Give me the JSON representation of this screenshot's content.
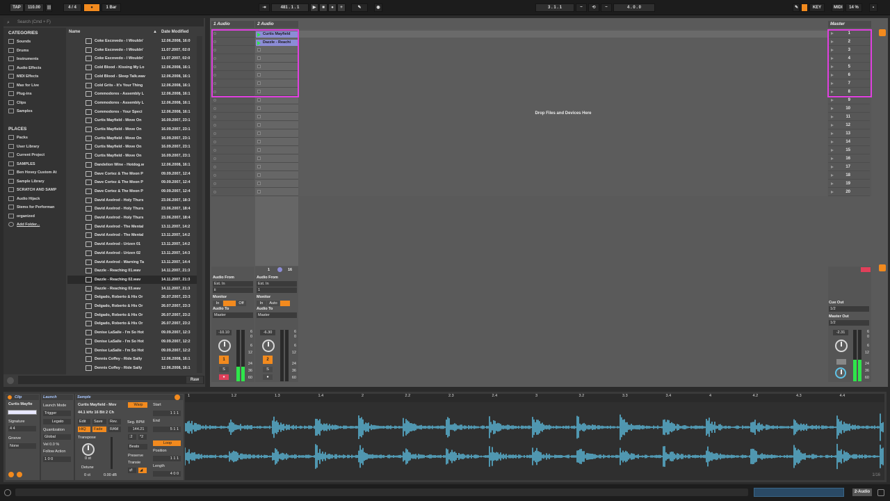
{
  "topbar": {
    "tap": "TAP",
    "tempo": "110.00",
    "signature": "4 / 4",
    "quant": "1 Bar",
    "position": "481 .  1 .  1",
    "loop_start": "3 .  1 .  1",
    "loop_length": "4 .  0 .  0",
    "key": "KEY",
    "midi": "MIDI",
    "cpu": "14 %"
  },
  "browser": {
    "search_placeholder": "Search (Cmd + F)",
    "categories_title": "CATEGORIES",
    "categories": [
      "Sounds",
      "Drums",
      "Instruments",
      "Audio Effects",
      "MIDI Effects",
      "Max for Live",
      "Plug-ins",
      "Clips",
      "Samples"
    ],
    "places_title": "PLACES",
    "places": [
      "Packs",
      "User Library",
      "Current Project",
      "SAMPLES",
      "Ben Hovey Custom At",
      "Sample Library",
      "SCRATCH AND SAMP",
      "Audio Hijack",
      "Stems for Performan",
      "organized",
      "Add Folder..."
    ],
    "col_name": "Name",
    "col_date": "Date Modified",
    "files": [
      [
        "Coke Escovedo - I Wouldn'",
        "12.06.2008, 16:0"
      ],
      [
        "Coke Escovedo - I Wouldn'",
        "11.07.2007, 02:0"
      ],
      [
        "Coke Escovedo - I Wouldn'",
        "11.07.2007, 02:0"
      ],
      [
        "Cold Blood - Kissing My Lo",
        "12.06.2008, 16:1"
      ],
      [
        "Cold Blood - Sleep Talk.wav",
        "12.06.2008, 16:1"
      ],
      [
        "Cold Grits - It's Your Thing",
        "12.06.2008, 16:1"
      ],
      [
        "Commodores - Assembly L",
        "12.06.2008, 16:1"
      ],
      [
        "Commodores - Assembly L",
        "12.06.2008, 16:1"
      ],
      [
        "Commodores - Your Speci",
        "12.06.2008, 16:1"
      ],
      [
        "Curtis Mayfield - Move On",
        "16.09.2007, 23:1"
      ],
      [
        "Curtis Mayfield - Move On",
        "16.09.2007, 23:1"
      ],
      [
        "Curtis Mayfield - Move On",
        "16.09.2007, 23:1"
      ],
      [
        "Curtis Mayfield - Move On",
        "16.09.2007, 23:1"
      ],
      [
        "Curtis Mayfield - Move On",
        "16.09.2007, 23:1"
      ],
      [
        "Dandelion Wine - Hotdog.w",
        "12.06.2008, 16:1"
      ],
      [
        "Dave Cortez & The Moon P",
        "09.09.2007, 12:4"
      ],
      [
        "Dave Cortez & The Moon P",
        "09.09.2007, 12:4"
      ],
      [
        "Dave Cortez & The Moon P",
        "09.09.2007, 12:4"
      ],
      [
        "David Axelrod - Holy Thurs",
        "23.06.2007, 18:3"
      ],
      [
        "David Axelrod - Holy Thurs",
        "23.06.2007, 18:4"
      ],
      [
        "David Axelrod - Holy Thurs",
        "23.06.2007, 18:4"
      ],
      [
        "David Axelrod - The Mental",
        "13.11.2007, 14:2"
      ],
      [
        "David Axelrod - The Mental",
        "13.11.2007, 14:2"
      ],
      [
        "David Axelrod - Urizen 01",
        "13.11.2007, 14:2"
      ],
      [
        "David Axelrod - Urizen 02",
        "13.11.2007, 14:3"
      ],
      [
        "David Axelrod - Warning Ta",
        "13.11.2007, 14:4"
      ],
      [
        "Dazzle - Reaching 01.wav",
        "14.11.2007, 21:3"
      ],
      [
        "Dazzle - Reaching 02.wav",
        "14.11.2007, 21:3"
      ],
      [
        "Dazzle - Reaching 03.wav",
        "14.11.2007, 21:3"
      ],
      [
        "Delgado, Roberto & His Or",
        "26.07.2007, 23:3"
      ],
      [
        "Delgado, Roberto & His Or",
        "26.07.2007, 23:3"
      ],
      [
        "Delgado, Roberto & His Or",
        "26.07.2007, 23:2"
      ],
      [
        "Delgado, Roberto & His Or",
        "26.07.2007, 23:2"
      ],
      [
        "Denise LaSalle - I'm So Hot",
        "09.09.2007, 12:3"
      ],
      [
        "Denise LaSalle - I'm So Hot",
        "09.09.2007, 12:2"
      ],
      [
        "Denise LaSalle - I'm So Hot",
        "09.09.2007, 12:2"
      ],
      [
        "Dennis Coffey - Ride Sally",
        "12.06.2008, 16:1"
      ],
      [
        "Dennis Coffey - Ride Sally",
        "12.06.2008, 16:1"
      ]
    ],
    "raw": "Raw"
  },
  "session": {
    "tracks": [
      {
        "name": "1 Audio"
      },
      {
        "name": "2 Audio"
      }
    ],
    "master": "Master",
    "clips": [
      "Curtis Mayfield",
      "Dazzle - Reachi"
    ],
    "drop_text": "Drop Files and Devices Here",
    "scenes": [
      "1",
      "2",
      "3",
      "4",
      "5",
      "6",
      "7",
      "8",
      "9",
      "10",
      "11",
      "12",
      "13",
      "14",
      "15",
      "16",
      "17",
      "18",
      "19",
      "20"
    ]
  },
  "mixer": {
    "audio_from": "Audio From",
    "ext_in": "Ext. In",
    "monitor": "Monitor",
    "in": "In",
    "auto": "Auto",
    "off": "Off",
    "audio_to": "Audio To",
    "master_out": "Master",
    "track1": {
      "input_ch": "ii",
      "vol": "-10.10",
      "num": "1",
      "s": "S"
    },
    "track2": {
      "input_ch": "1",
      "vol": "-6.30",
      "num": "2",
      "s": "S"
    },
    "master": {
      "vol": "-2.31",
      "cue_out": "Cue Out",
      "cue_val": "1/2",
      "master_out_label": "Master Out",
      "master_out_val": "1/2"
    },
    "db_scale": [
      "6",
      "0",
      "6",
      "12",
      "24",
      "36",
      "60"
    ],
    "io_row": {
      "a": "1",
      "b": "16"
    }
  },
  "clipview": {
    "tab_clip": "Clip",
    "tab_launch": "Launch",
    "tab_sample": "Sample",
    "clip_name": "Curtis Mayfie",
    "signature": "Signature",
    "sig_val": "4   4",
    "groove": "Groove",
    "groove_val": "None",
    "launch_mode": "Launch Mode",
    "launch_mode_val": "Trigger",
    "legato": "Legato",
    "quantization": "Quantization",
    "quant_val": "Global",
    "vel": "Vel   0.0 %",
    "follow_action": "Follow Action",
    "fa_val": "1   0   0",
    "sample_name": "Curtis Mayfield - Mov",
    "sample_info": "44.1 kHz 16 Bit 2 Ch",
    "warp": "Warp",
    "edit": "Edit",
    "save": "Save",
    "rev": "Rev.",
    "ram": "RAM",
    "hiq": "HiQ",
    "fade": "Fade",
    "seg_bpm": "Seg. BPM",
    "bpm_val": "144.21",
    "half": ":2",
    "dbl": "*2",
    "transpose": "Transpose",
    "transpose_val": "0 st",
    "beats": "Beats",
    "preserve": "Preserve",
    "transients": "Transie",
    "detune": "Detune",
    "detune_val": "0 ct",
    "gain_val": "0.00 dB",
    "start": "Start",
    "start_val": "1   1   1",
    "end": "End",
    "end_val": "5   1   1",
    "loop": "Loop",
    "position": "Position",
    "pos_val": "1   1   1",
    "length": "Length",
    "length_val": "4   0   0",
    "zoom": "1/16",
    "ruler": [
      "1",
      "1.2",
      "1.3",
      "1.4",
      "2",
      "2.2",
      "2.3",
      "2.4",
      "3",
      "3.2",
      "3.3",
      "3.4",
      "4",
      "4.2",
      "4.3",
      "4.4"
    ]
  },
  "status": {
    "track_chip": "2-Audio"
  },
  "colors": {
    "accent": "#f28a1e",
    "clip": "#8c8cd6",
    "waveform": "#5fc4e8",
    "highlight": "#e040e0",
    "meter": "#2ee64a"
  }
}
